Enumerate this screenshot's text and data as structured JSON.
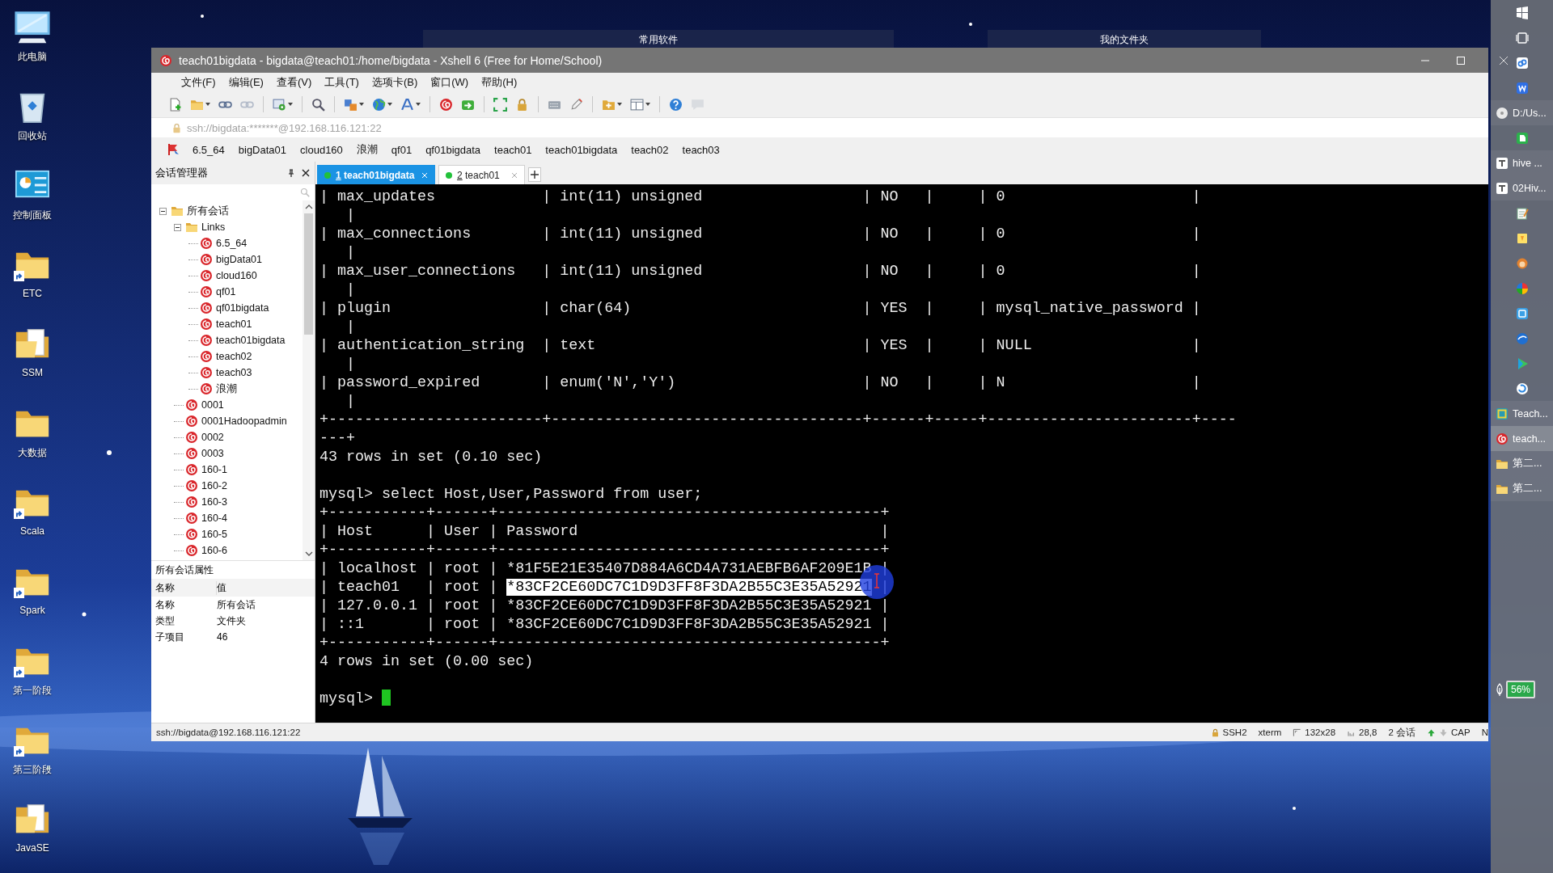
{
  "desktop": {
    "fences": [
      {
        "label": "常用软件"
      },
      {
        "label": "我的文件夹"
      }
    ],
    "icons": [
      {
        "label": "此电脑",
        "kind": "computer",
        "shortcut": false
      },
      {
        "label": "回收站",
        "kind": "recycle-bin",
        "shortcut": false
      },
      {
        "label": "控制面板",
        "kind": "control-panel",
        "shortcut": false
      },
      {
        "label": "ETC",
        "kind": "folder",
        "shortcut": true
      },
      {
        "label": "SSM",
        "kind": "doc-folder",
        "shortcut": false
      },
      {
        "label": "大数据",
        "kind": "folder",
        "shortcut": false
      },
      {
        "label": "Scala",
        "kind": "folder",
        "shortcut": true
      },
      {
        "label": "Spark",
        "kind": "folder",
        "shortcut": true
      },
      {
        "label": "第一阶段",
        "kind": "folder",
        "shortcut": true
      },
      {
        "label": "第三阶段",
        "kind": "folder",
        "shortcut": true
      },
      {
        "label": "JavaSE",
        "kind": "doc-folder",
        "shortcut": false
      }
    ]
  },
  "window": {
    "title": "teach01bigdata - bigdata@teach01:/home/bigdata - Xshell 6 (Free for Home/School)",
    "menu": [
      "文件(F)",
      "编辑(E)",
      "查看(V)",
      "工具(T)",
      "选项卡(B)",
      "窗口(W)",
      "帮助(H)"
    ],
    "toolbar": [
      [
        {
          "kind": "new-session",
          "dropdown": false,
          "disabled": false
        },
        {
          "kind": "open-folder",
          "dropdown": true,
          "disabled": false
        },
        {
          "kind": "link",
          "dropdown": false,
          "disabled": false
        },
        {
          "kind": "link",
          "dropdown": false,
          "disabled": true
        }
      ],
      [
        {
          "kind": "properties",
          "dropdown": true,
          "disabled": false
        }
      ],
      [
        {
          "kind": "search",
          "dropdown": false,
          "disabled": false
        }
      ],
      [
        {
          "kind": "transfer",
          "dropdown": true,
          "disabled": false
        },
        {
          "kind": "globe",
          "dropdown": true,
          "disabled": false
        },
        {
          "kind": "font",
          "dropdown": true,
          "disabled": false
        }
      ],
      [
        {
          "kind": "xshell",
          "dropdown": false,
          "disabled": false
        },
        {
          "kind": "xftp",
          "dropdown": false,
          "disabled": false
        }
      ],
      [
        {
          "kind": "fullscreen",
          "dropdown": false,
          "disabled": false
        },
        {
          "kind": "lock",
          "dropdown": false,
          "disabled": false
        }
      ],
      [
        {
          "kind": "keyboard",
          "dropdown": false,
          "disabled": false
        },
        {
          "kind": "pen",
          "dropdown": false,
          "disabled": false
        }
      ],
      [
        {
          "kind": "new-folder",
          "dropdown": true,
          "disabled": false
        },
        {
          "kind": "layout",
          "dropdown": true,
          "disabled": false
        }
      ],
      [
        {
          "kind": "help",
          "dropdown": false,
          "disabled": false
        },
        {
          "kind": "chat",
          "dropdown": false,
          "disabled": true
        }
      ]
    ],
    "address": "ssh://bigdata:*******@192.168.116.121:22",
    "links": [
      "6.5_64",
      "bigData01",
      "cloud160",
      "浪潮",
      "qf01",
      "qf01bigdata",
      "teach01",
      "teach01bigdata",
      "teach02",
      "teach03"
    ],
    "session_manager": {
      "title": "会话管理器",
      "tree": [
        {
          "label": "所有会话",
          "kind": "folder",
          "expanded": true,
          "children": [
            {
              "label": "Links",
              "kind": "folder",
              "expanded": true,
              "children": [
                {
                  "label": "6.5_64",
                  "kind": "session"
                },
                {
                  "label": "bigData01",
                  "kind": "session"
                },
                {
                  "label": "cloud160",
                  "kind": "session"
                },
                {
                  "label": "qf01",
                  "kind": "session"
                },
                {
                  "label": "qf01bigdata",
                  "kind": "session"
                },
                {
                  "label": "teach01",
                  "kind": "session"
                },
                {
                  "label": "teach01bigdata",
                  "kind": "session"
                },
                {
                  "label": "teach02",
                  "kind": "session"
                },
                {
                  "label": "teach03",
                  "kind": "session"
                },
                {
                  "label": "浪潮",
                  "kind": "session"
                }
              ]
            },
            {
              "label": "0001",
              "kind": "session"
            },
            {
              "label": "0001Hadoopadmin",
              "kind": "session"
            },
            {
              "label": "0002",
              "kind": "session"
            },
            {
              "label": "0003",
              "kind": "session"
            },
            {
              "label": "160-1",
              "kind": "session"
            },
            {
              "label": "160-2",
              "kind": "session"
            },
            {
              "label": "160-3",
              "kind": "session"
            },
            {
              "label": "160-4",
              "kind": "session"
            },
            {
              "label": "160-5",
              "kind": "session"
            },
            {
              "label": "160-6",
              "kind": "session"
            }
          ]
        }
      ],
      "properties": {
        "title": "所有会话属性",
        "columns": [
          "名称",
          "值"
        ],
        "rows": [
          [
            "名称",
            "所有会话"
          ],
          [
            "类型",
            "文件夹"
          ],
          [
            "子项目",
            "46"
          ]
        ]
      }
    },
    "tabs": [
      {
        "number": "1",
        "label": "teach01bigdata",
        "selected": true
      },
      {
        "number": "2",
        "label": "teach01",
        "selected": false
      }
    ],
    "terminal": {
      "blocks": [
        [
          {
            "text": "| max_updates            | int(11) unsigned                  | NO   |     | 0                     |"
          },
          {
            "text": "   |"
          },
          {
            "text": "| max_connections        | int(11) unsigned                  | NO   |     | 0                     |"
          },
          {
            "text": "   |"
          },
          {
            "text": "| max_user_connections   | int(11) unsigned                  | NO   |     | 0                     |"
          },
          {
            "text": "   |"
          },
          {
            "text": "| plugin                 | char(64)                          | YES  |     | mysql_native_password |"
          },
          {
            "text": "   |"
          },
          {
            "text": "| authentication_string  | text                              | YES  |     | NULL                  |"
          },
          {
            "text": "   |"
          },
          {
            "text": "| password_expired       | enum('N','Y')                     | NO   |     | N                     |"
          },
          {
            "text": "   |"
          },
          {
            "text": "+------------------------+-----------------------------------+------+-----+-----------------------+----"
          },
          {
            "text": "---+"
          },
          {
            "text": "43 rows in set (0.10 sec)"
          }
        ],
        [
          {
            "text": "mysql> select Host,User,Password from user;"
          },
          {
            "text": "+-----------+------+-------------------------------------------+"
          },
          {
            "text": "| Host      | User | Password                                  |"
          },
          {
            "text": "+-----------+------+-------------------------------------------+"
          },
          {
            "text": "| localhost | root | *81F5E21E35407D884A6CD4A731AEBFB6AF209E1B |"
          },
          {
            "text": "| teach01   | root | ",
            "selected_text": "*83CF2CE60DC7C1D9D3FF8F3DA2B55C3E35A52921",
            "rest": " |"
          },
          {
            "text": "| 127.0.0.1 | root | *83CF2CE60DC7C1D9D3FF8F3DA2B55C3E35A52921 |"
          },
          {
            "text": "| ::1       | root | *83CF2CE60DC7C1D9D3FF8F3DA2B55C3E35A52921 |"
          },
          {
            "text": "+-----------+------+-------------------------------------------+"
          },
          {
            "text": "4 rows in set (0.00 sec)"
          }
        ]
      ],
      "prompt": {
        "text": "mysql>",
        "cursor": true
      }
    },
    "status_bar": {
      "address": "ssh://bigdata@192.168.116.121:22",
      "items": [
        {
          "kind": "lock",
          "text": "SSH2"
        },
        {
          "text": "xterm"
        },
        {
          "kind": "resize",
          "text": "132x28"
        },
        {
          "kind": "cursor-pos",
          "text": "28,8"
        },
        {
          "text": "2 会话"
        },
        {
          "kind": "up-arrow"
        },
        {
          "kind": "down-arrow"
        },
        {
          "text": "CAP"
        },
        {
          "text": "N"
        }
      ]
    }
  },
  "taskbar": {
    "items": [
      {
        "kind": "windows",
        "active": false
      },
      {
        "kind": "task-view",
        "active": false
      },
      {
        "kind": "cloud",
        "active": false
      },
      {
        "kind": "word",
        "active": false
      },
      {
        "kind": "disk",
        "label": "D:/Us...",
        "active": false
      },
      {
        "kind": "evernote",
        "active": false
      },
      {
        "kind": "t-app",
        "label": "hive ...",
        "active": false
      },
      {
        "kind": "t-app",
        "label": "02Hiv...",
        "active": false
      },
      {
        "kind": "notepad",
        "active": false
      },
      {
        "kind": "sticky",
        "active": false
      },
      {
        "kind": "monkey",
        "active": false
      },
      {
        "kind": "color-wheel",
        "active": false
      },
      {
        "kind": "square-app",
        "active": false
      },
      {
        "kind": "browser",
        "active": false
      },
      {
        "kind": "play",
        "active": false
      },
      {
        "kind": "circle-arrow",
        "active": false
      },
      {
        "kind": "teach",
        "label": "Teach...",
        "active": false
      },
      {
        "kind": "xshell",
        "label": "teach...",
        "active": true
      },
      {
        "kind": "folder",
        "label": "第二...",
        "active": false
      },
      {
        "kind": "folder",
        "label": "第二...",
        "active": false
      }
    ],
    "battery": "56%"
  }
}
